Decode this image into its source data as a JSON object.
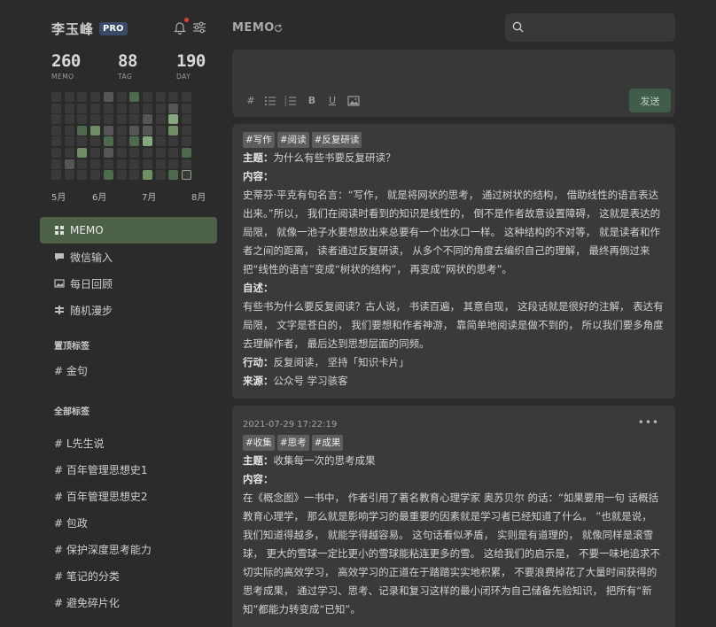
{
  "user": {
    "name": "李玉峰",
    "badge": "PRO"
  },
  "stats": [
    {
      "value": "260",
      "label": "MEMO"
    },
    {
      "value": "88",
      "label": "TAG"
    },
    {
      "value": "190",
      "label": "DAY"
    }
  ],
  "heatmap": {
    "colors": {
      "empty": "#3a3a3a",
      "low": "#555555",
      "mid": "#4d6a4c",
      "high": "#6e8f66",
      "max": "#86a87e",
      "today_border": "#86a87e"
    },
    "levels": [
      [
        0,
        0,
        0,
        0,
        1,
        0,
        2,
        0,
        0,
        0,
        0
      ],
      [
        0,
        0,
        0,
        0,
        0,
        0,
        0,
        0,
        0,
        1,
        0
      ],
      [
        0,
        0,
        0,
        0,
        0,
        0,
        0,
        1,
        0,
        4,
        0
      ],
      [
        0,
        0,
        2,
        3,
        1,
        0,
        1,
        1,
        0,
        3,
        0
      ],
      [
        0,
        0,
        0,
        0,
        2,
        0,
        2,
        4,
        0,
        0,
        0
      ],
      [
        0,
        0,
        3,
        0,
        1,
        0,
        0,
        0,
        0,
        0,
        2
      ],
      [
        0,
        1,
        0,
        0,
        0,
        0,
        0,
        0,
        0,
        0,
        0
      ],
      [
        0,
        0,
        0,
        0,
        2,
        0,
        0,
        3,
        0,
        2,
        5
      ]
    ]
  },
  "months": [
    "5月",
    "6月",
    "7月",
    "8月"
  ],
  "nav": [
    {
      "label": "MEMO",
      "icon": "grid-icon",
      "active": true
    },
    {
      "label": "微信输入",
      "icon": "chat-icon",
      "active": false
    },
    {
      "label": "每日回顾",
      "icon": "image-icon",
      "active": false
    },
    {
      "label": "随机漫步",
      "icon": "shuffle-icon",
      "active": false
    }
  ],
  "pinned": {
    "title": "置顶标签",
    "tags": [
      "# 金句"
    ]
  },
  "all_tags": {
    "title": "全部标签",
    "tags": [
      "# L先生说",
      "# 百年管理思想史1",
      "# 百年管理思想史2",
      "# 包政",
      "# 保护深度思考能力",
      "# 笔记的分类",
      "# 避免碎片化"
    ]
  },
  "header": {
    "title": "MEMO"
  },
  "editor": {
    "send_label": "发送",
    "tools": [
      "#",
      "bullet-list-icon",
      "numbered-list-icon",
      "B",
      "U",
      "image-icon"
    ]
  },
  "memos": [
    {
      "tags": [
        "#写作",
        "#阅读",
        "#反复研读"
      ],
      "topic_label": "主题：",
      "topic": "为什么有些书要反复研读？",
      "content_label": "内容：",
      "content": "史蒂芬·平克有句名言：“写作， 就是将网状的思考， 通过树状的结构， 借助线性的语言表达出来。”所以， 我们在阅读时看到的知识是线性的， 倒不是作者故意设置障碍， 这就是表达的局限， 就像一池子水要想放出来总要有一个出水口一样。 这种结构的不对等， 就是读者和作者之间的距离， 读者通过反复研读， 从多个不同的角度去编织自己的理解， 最终再倒过来把“线性的语言”变成“树状的结构”， 再变成“网状的思考”。",
      "self_label": "自述：",
      "self": "有些书为什么要反复阅读？古人说， 书读百遍， 其意自现， 这段话就是很好的注解， 表达有局限， 文字是苍白的， 我们要想和作者神游， 靠简单地阅读是做不到的， 所以我们要多角度去理解作者， 最后达到思想层面的同频。",
      "action_label": "行动：",
      "action": "反复阅读， 坚持「知识卡片」",
      "source_label": "来源：",
      "source": "公众号 学习骇客"
    },
    {
      "time": "2021-07-29 17:22:19",
      "tags": [
        "#收集",
        "#思考",
        "#成果"
      ],
      "topic_label": "主题：",
      "topic": "收集每一次的思考成果",
      "content_label": "内容：",
      "content": "在《概念图》一书中， 作者引用了著名教育心理学家 奥苏贝尔 的话：“如果要用一句 话概括教育心理学， 那么就是影响学习的最重要的因素就是学习者已经知道了什么。 ”也就是说， 我们知道得越多， 就能学得越容易。 这句话看似矛盾， 实则是有道理的， 就像同样是滚雪球， 更大的雪球一定比更小的雪球能粘连更多的雪。 这给我们的启示是， 不要一味地追求不切实际的高效学习， 高效学习的正道在于踏踏实实地积累， 不要浪费掉花了大量时间获得的思考成果， 通过学习、思考、记录和复习这样的最小闭环为自己储备先验知识， 把所有“新知”都能力转变成“已知”。"
    }
  ]
}
